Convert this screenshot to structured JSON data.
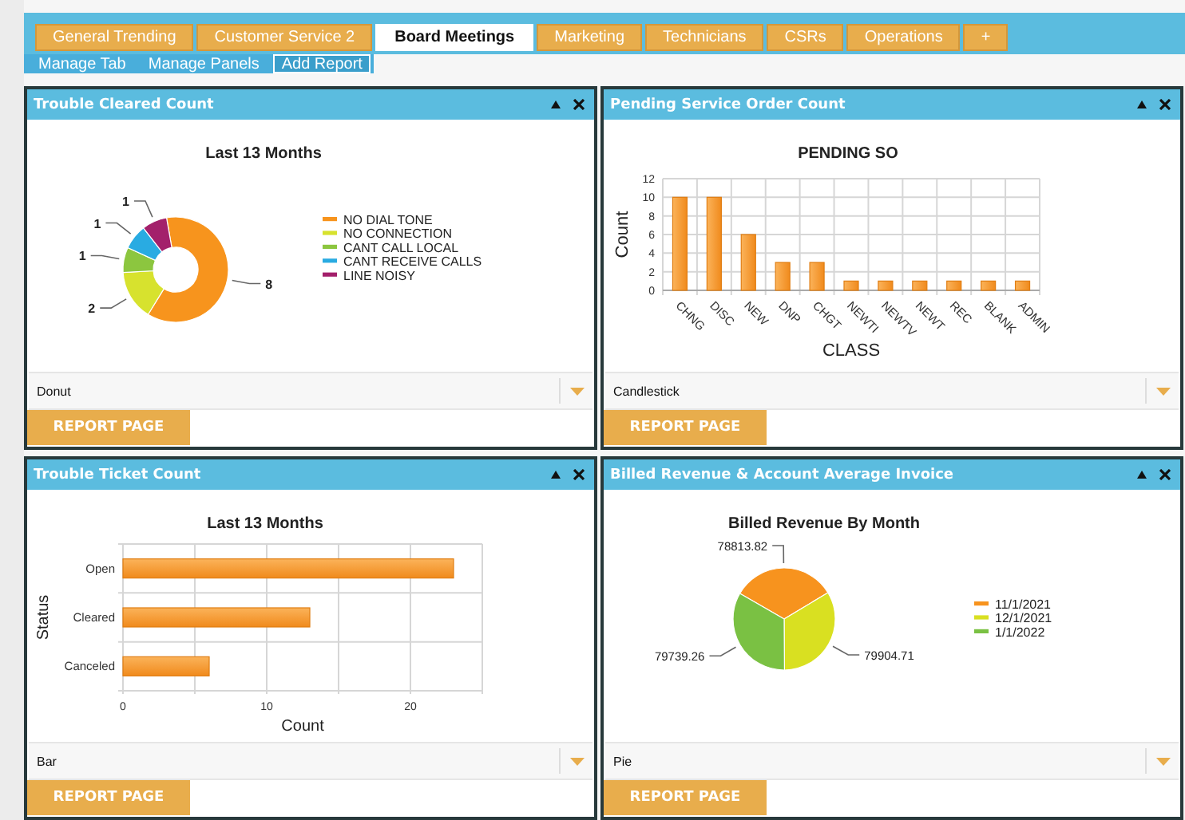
{
  "tabs": [
    {
      "label": "General Trending",
      "selected": false
    },
    {
      "label": "Customer Service 2",
      "selected": false
    },
    {
      "label": "Board Meetings",
      "selected": true
    },
    {
      "label": "Marketing",
      "selected": false
    },
    {
      "label": "Technicians",
      "selected": false
    },
    {
      "label": "CSRs",
      "selected": false
    },
    {
      "label": "Operations",
      "selected": false
    },
    {
      "label": "+",
      "selected": false
    }
  ],
  "tab_actions": [
    {
      "label": "Manage Tab",
      "selected": false
    },
    {
      "label": "Manage Panels",
      "selected": false
    },
    {
      "label": "Add Report",
      "selected": true
    }
  ],
  "panels": [
    {
      "title": "Trouble Cleared Count",
      "chart_type": "Donut",
      "button": "REPORT PAGE",
      "chart_data": {
        "type": "donut",
        "title": "Last 13 Months",
        "categories": [
          "NO DIAL TONE",
          "NO CONNECTION",
          "CANT CALL LOCAL",
          "CANT RECEIVE CALLS",
          "LINE NOISY"
        ],
        "series": [
          {
            "values": [
              8,
              2,
              1,
              1,
              1
            ]
          }
        ],
        "data_labels": true,
        "legend": true
      }
    },
    {
      "title": "Pending Service Order Count",
      "chart_type": "Candlestick",
      "button": "REPORT PAGE",
      "chart_data": {
        "type": "bar",
        "title": "PENDING SO",
        "xlabel": "CLASS",
        "ylabel": "Count",
        "categories": [
          "CHNG",
          "DISC",
          "NEW",
          "DNP",
          "CHGT",
          "NEWTI",
          "NEWTV",
          "NEWT",
          "REC",
          "BLANK",
          "ADMIN"
        ],
        "series": [
          {
            "values": [
              10,
              10,
              6,
              3,
              3,
              1,
              1,
              1,
              1,
              1,
              1
            ]
          }
        ],
        "ylim": [
          0,
          12
        ],
        "yticks": [
          0,
          2,
          4,
          6,
          8,
          10,
          12
        ],
        "grid": true
      }
    },
    {
      "title": "Trouble Ticket Count",
      "chart_type": "Bar",
      "button": "REPORT PAGE",
      "chart_data": {
        "type": "bar",
        "orientation": "horizontal",
        "title": "Last 13 Months",
        "xlabel": "Count",
        "ylabel": "Status",
        "categories": [
          "Open",
          "Cleared",
          "Canceled"
        ],
        "series": [
          {
            "values": [
              23,
              13,
              6
            ]
          }
        ],
        "xlim": [
          0,
          25
        ],
        "xticks": [
          0,
          10,
          20
        ],
        "grid": true
      }
    },
    {
      "title": "Billed Revenue & Account Average Invoice",
      "chart_type": "Pie",
      "button": "REPORT PAGE",
      "chart_data": {
        "type": "pie",
        "title": "Billed Revenue By Month",
        "categories": [
          "11/1/2021",
          "12/1/2021",
          "1/1/2022"
        ],
        "series": [
          {
            "values": [
              78813.82,
              79904.71,
              79739.26
            ]
          }
        ],
        "data_labels": true,
        "legend": true
      }
    }
  ]
}
